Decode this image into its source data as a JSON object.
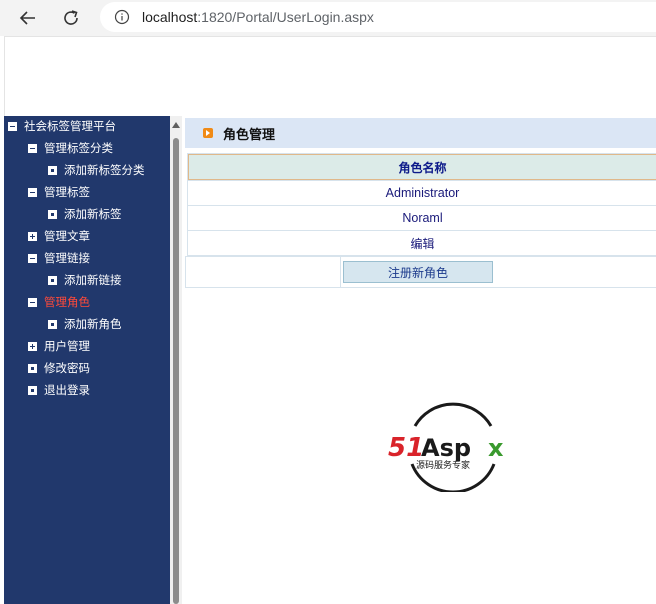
{
  "browser": {
    "url_host": "localhost",
    "url_path": ":1820/Portal/UserLogin.aspx"
  },
  "tree": {
    "root": "社会标签管理平台",
    "items": [
      {
        "label": "管理标签分类",
        "type": "minus"
      },
      {
        "label": "添加新标签分类",
        "type": "leaf"
      },
      {
        "label": "管理标签",
        "type": "minus"
      },
      {
        "label": "添加新标签",
        "type": "leaf"
      },
      {
        "label": "管理文章",
        "type": "plus"
      },
      {
        "label": "管理链接",
        "type": "minus"
      },
      {
        "label": "添加新链接",
        "type": "leaf"
      },
      {
        "label": "管理角色",
        "type": "minus",
        "active": true
      },
      {
        "label": "添加新角色",
        "type": "leaf"
      },
      {
        "label": "用户管理",
        "type": "plus"
      },
      {
        "label": "修改密码",
        "type": "leaf"
      },
      {
        "label": "退出登录",
        "type": "leaf"
      }
    ]
  },
  "main": {
    "section_title": "角色管理",
    "table": {
      "header": "角色名称",
      "rows": [
        "Administrator",
        "Noraml"
      ],
      "edit_label": "编辑"
    },
    "register_button": "注册新角色"
  },
  "logo": {
    "brand_51": "51",
    "brand_asp": "Asp",
    "brand_x": "x",
    "tagline": "源码服务专家"
  },
  "colors": {
    "sidebar_bg": "#21386c",
    "active_item": "#ff4a3a",
    "header_bg": "#dbe6f5",
    "brand_red": "#d9232a",
    "brand_green": "#3a9a2e"
  }
}
